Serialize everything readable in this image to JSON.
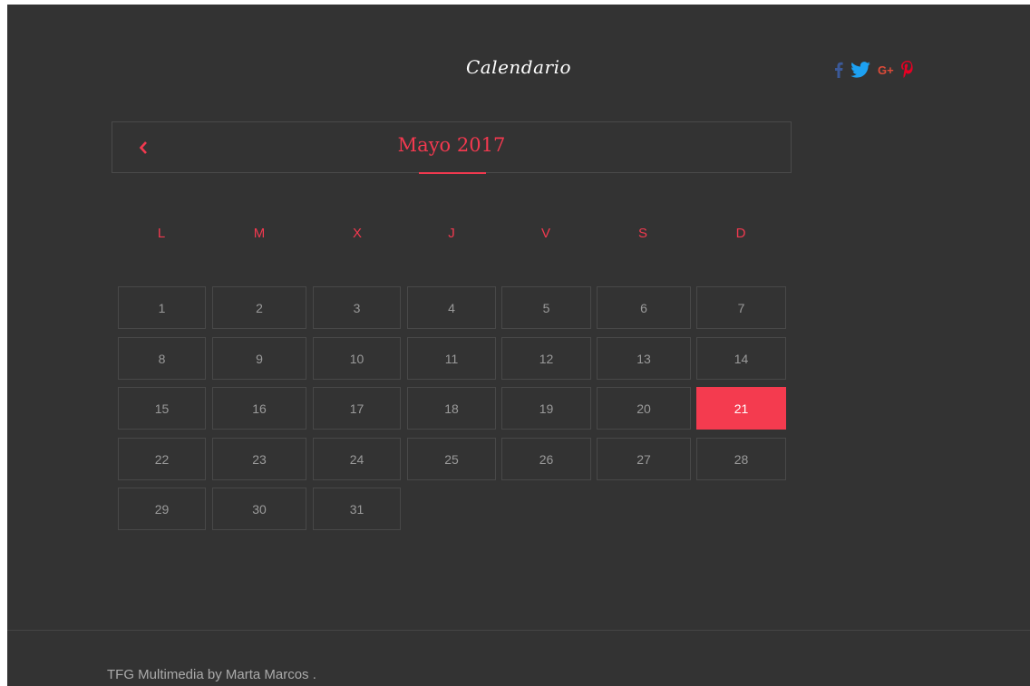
{
  "page": {
    "title": "Calendario"
  },
  "social": {
    "facebook": {
      "icon": "facebook-icon",
      "color": "#3b5998"
    },
    "twitter": {
      "icon": "twitter-icon",
      "color": "#1da1f2"
    },
    "googleplus": {
      "icon": "google-plus-icon",
      "label": "G+",
      "color": "#dd4b39"
    },
    "pinterest": {
      "icon": "pinterest-icon",
      "color": "#e60023"
    }
  },
  "calendar": {
    "month_label": "Mayo 2017",
    "prev_icon": "chevron-left-icon",
    "weekdays": [
      "L",
      "M",
      "X",
      "J",
      "V",
      "S",
      "D"
    ],
    "weeks": [
      [
        "1",
        "2",
        "3",
        "4",
        "5",
        "6",
        "7"
      ],
      [
        "8",
        "9",
        "10",
        "11",
        "12",
        "13",
        "14"
      ],
      [
        "15",
        "16",
        "17",
        "18",
        "19",
        "20",
        "21"
      ],
      [
        "22",
        "23",
        "24",
        "25",
        "26",
        "27",
        "28"
      ],
      [
        "29",
        "30",
        "31"
      ]
    ],
    "selected_day": "21",
    "accent_color": "#f2394f"
  },
  "footer": {
    "text": "TFG Multimedia by Marta Marcos ."
  }
}
